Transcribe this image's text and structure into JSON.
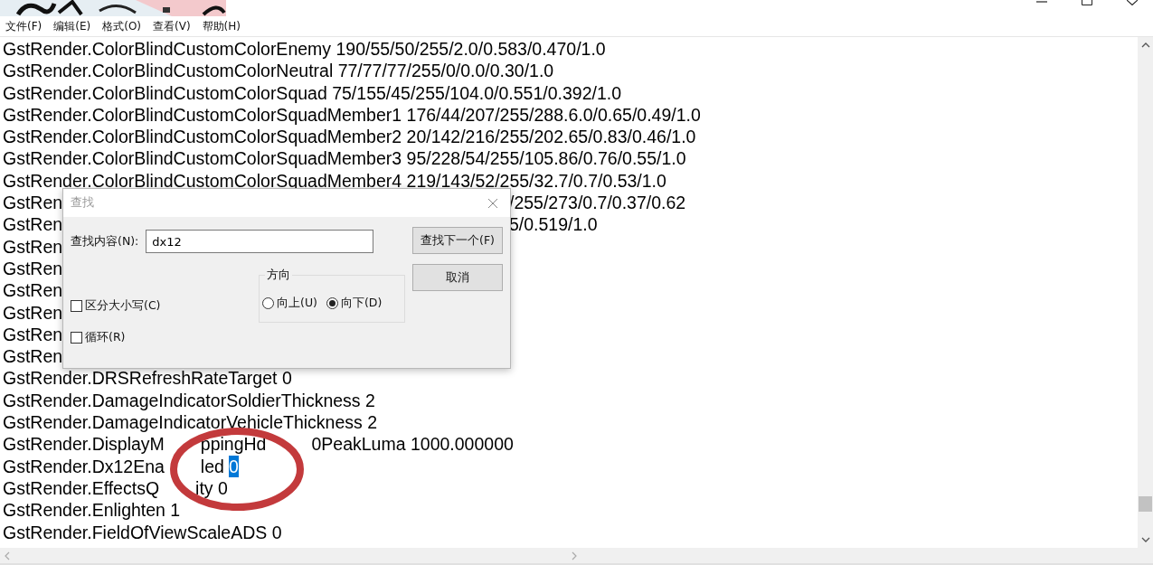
{
  "menu": [
    {
      "label": "文件(F)"
    },
    {
      "label": "编辑(E)"
    },
    {
      "label": "格式(O)"
    },
    {
      "label": "查看(V)"
    },
    {
      "label": "帮助(H)"
    }
  ],
  "lines": [
    {
      "kind": "plain",
      "segments": [
        {
          "kind": "text",
          "text": "GstRender.ColorBlindCustomColorEnemy 190/55/50/255/2.0/0.583/0.470/1.0"
        }
      ]
    },
    {
      "kind": "plain",
      "segments": [
        {
          "kind": "text",
          "text": "GstRender.ColorBlindCustomColorNeutral 77/77/77/255/0/0.0/0.30/1.0"
        }
      ]
    },
    {
      "kind": "plain",
      "segments": [
        {
          "kind": "text",
          "text": "GstRender.ColorBlindCustomColorSquad 75/155/45/255/104.0/0.551/0.392/1.0"
        }
      ]
    },
    {
      "kind": "plain",
      "segments": [
        {
          "kind": "text",
          "text": "GstRender.ColorBlindCustomColorSquadMember1 176/44/207/255/288.6.0/0.65/0.49/1.0"
        }
      ]
    },
    {
      "kind": "plain",
      "segments": [
        {
          "kind": "text",
          "text": "GstRender.ColorBlindCustomColorSquadMember2 20/142/216/255/202.65/0.83/0.46/1.0"
        }
      ]
    },
    {
      "kind": "plain",
      "segments": [
        {
          "kind": "text",
          "text": "GstRender.ColorBlindCustomColorSquadMember3 95/228/54/255/105.86/0.76/0.55/1.0"
        }
      ]
    },
    {
      "kind": "plain",
      "segments": [
        {
          "kind": "text",
          "text": "GstRender.ColorBlindCustomColorSquadMember4 219/143/52/255/32.7/0.7/0.53/1.0"
        }
      ]
    },
    {
      "kind": "under-dialog",
      "segments": [
        {
          "kind": "text",
          "text": "GstRen"
        },
        {
          "kind": "text",
          "text": "/255/273/0.7/0.37/0.62"
        }
      ]
    },
    {
      "kind": "under-dialog",
      "segments": [
        {
          "kind": "text",
          "text": "GstRen"
        },
        {
          "kind": "text",
          "text": "5/0.519/1.0"
        }
      ]
    },
    {
      "kind": "under-dialog",
      "segments": [
        {
          "kind": "text",
          "text": "GstRen"
        }
      ]
    },
    {
      "kind": "under-dialog",
      "segments": [
        {
          "kind": "text",
          "text": "GstRen"
        }
      ]
    },
    {
      "kind": "under-dialog",
      "segments": [
        {
          "kind": "text",
          "text": "GstRen"
        }
      ]
    },
    {
      "kind": "under-dialog",
      "segments": [
        {
          "kind": "text",
          "text": "GstRen"
        }
      ]
    },
    {
      "kind": "under-dialog",
      "segments": [
        {
          "kind": "text",
          "text": "GstRen"
        }
      ]
    },
    {
      "kind": "under-dialog",
      "segments": [
        {
          "kind": "text",
          "text": "GstRen"
        }
      ]
    },
    {
      "kind": "plain",
      "segments": [
        {
          "kind": "text",
          "text": "GstRender.DRSRefreshRateTarget 0"
        }
      ]
    },
    {
      "kind": "plain",
      "segments": [
        {
          "kind": "text",
          "text": "GstRender.DamageIndicatorSoldierThickness 2"
        }
      ]
    },
    {
      "kind": "plain",
      "segments": [
        {
          "kind": "text",
          "text": "GstRender.DamageIndicatorVehicleThickness 2"
        }
      ]
    },
    {
      "kind": "plain",
      "segments": [
        {
          "kind": "text",
          "text": "GstRender.DisplayM"
        },
        {
          "kind": "text",
          "text": "ppingHd"
        },
        {
          "kind": "text",
          "text": "0PeakLuma 1000.000000"
        }
      ]
    },
    {
      "kind": "plain",
      "segments": [
        {
          "kind": "text",
          "text": "GstRender.Dx12Ena"
        },
        {
          "kind": "text",
          "text": "led"
        },
        {
          "kind": "selection",
          "text": "0"
        }
      ]
    },
    {
      "kind": "plain",
      "segments": [
        {
          "kind": "text",
          "text": "GstRender.EffectsQ"
        },
        {
          "kind": "text",
          "text": "ity 0"
        }
      ]
    },
    {
      "kind": "plain",
      "segments": [
        {
          "kind": "text",
          "text": "GstRender.Enlighten 1"
        }
      ]
    },
    {
      "kind": "plain",
      "segments": [
        {
          "kind": "text",
          "text": "GstRender.FieldOfViewScaleADS 0"
        }
      ]
    }
  ],
  "find_dialog": {
    "title": "查找",
    "label": "查找内容(N):",
    "value": "dx12",
    "find_next": "查找下一个(F)",
    "cancel": "取消",
    "direction": {
      "title": "方向",
      "options": [
        {
          "label": "向上(U)",
          "selected": false
        },
        {
          "label": "向下(D)",
          "selected": true
        }
      ]
    },
    "checkboxes": [
      {
        "label": "区分大小写(C)",
        "checked": false
      },
      {
        "label": "循环(R)",
        "checked": false
      }
    ]
  }
}
